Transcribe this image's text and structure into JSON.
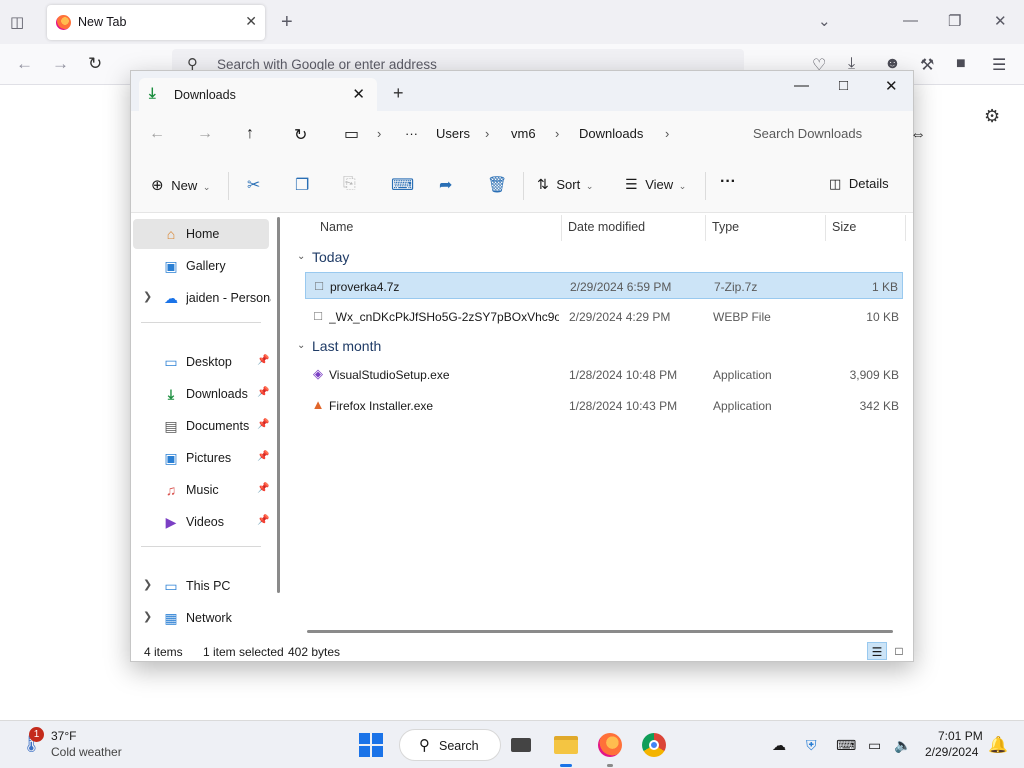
{
  "browser": {
    "tab_title": "New Tab",
    "new_tab_symbol": "+",
    "url_placeholder": "Search with Google or enter address"
  },
  "explorer": {
    "tab_title": "Downloads",
    "breadcrumb": {
      "more": "···",
      "items": [
        "Users",
        "vm6",
        "Downloads"
      ]
    },
    "search_placeholder": "Search Downloads",
    "toolbar": {
      "new_label": "New",
      "sort_label": "Sort",
      "view_label": "View",
      "more_label": "···",
      "details_label": "Details"
    },
    "nav": {
      "home": "Home",
      "gallery": "Gallery",
      "onedrive": "jaiden - Personal",
      "desktop": "Desktop",
      "downloads": "Downloads",
      "documents": "Documents",
      "pictures": "Pictures",
      "music": "Music",
      "videos": "Videos",
      "this_pc": "This PC",
      "network": "Network"
    },
    "columns": {
      "name": "Name",
      "date": "Date modified",
      "type": "Type",
      "size": "Size"
    },
    "groups": [
      {
        "label": "Today",
        "files": [
          {
            "name": "proverka4.7z",
            "date": "2/29/2024 6:59 PM",
            "type": "7-Zip.7z",
            "size": "1 KB",
            "selected": true
          },
          {
            "name": "_Wx_cnDKcPkJfSHo5G-2zSY7pBOxVhc9ot...",
            "date": "2/29/2024 4:29 PM",
            "type": "WEBP File",
            "size": "10 KB",
            "selected": false
          }
        ]
      },
      {
        "label": "Last month",
        "files": [
          {
            "name": "VisualStudioSetup.exe",
            "date": "1/28/2024 10:48 PM",
            "type": "Application",
            "size": "3,909 KB",
            "selected": false
          },
          {
            "name": "Firefox Installer.exe",
            "date": "1/28/2024 10:43 PM",
            "type": "Application",
            "size": "342 KB",
            "selected": false
          }
        ]
      }
    ],
    "status": {
      "items": "4 items",
      "selected": "1 item selected",
      "bytes": "402 bytes"
    }
  },
  "taskbar": {
    "weather_badge": "1",
    "weather_temp": "37°F",
    "weather_desc": "Cold weather",
    "search_label": "Search",
    "time": "7:01 PM",
    "date": "2/29/2024"
  },
  "colors": {
    "selection": "#cce4f7",
    "accent": "#1a73e8",
    "group_header": "#1f3b66"
  }
}
